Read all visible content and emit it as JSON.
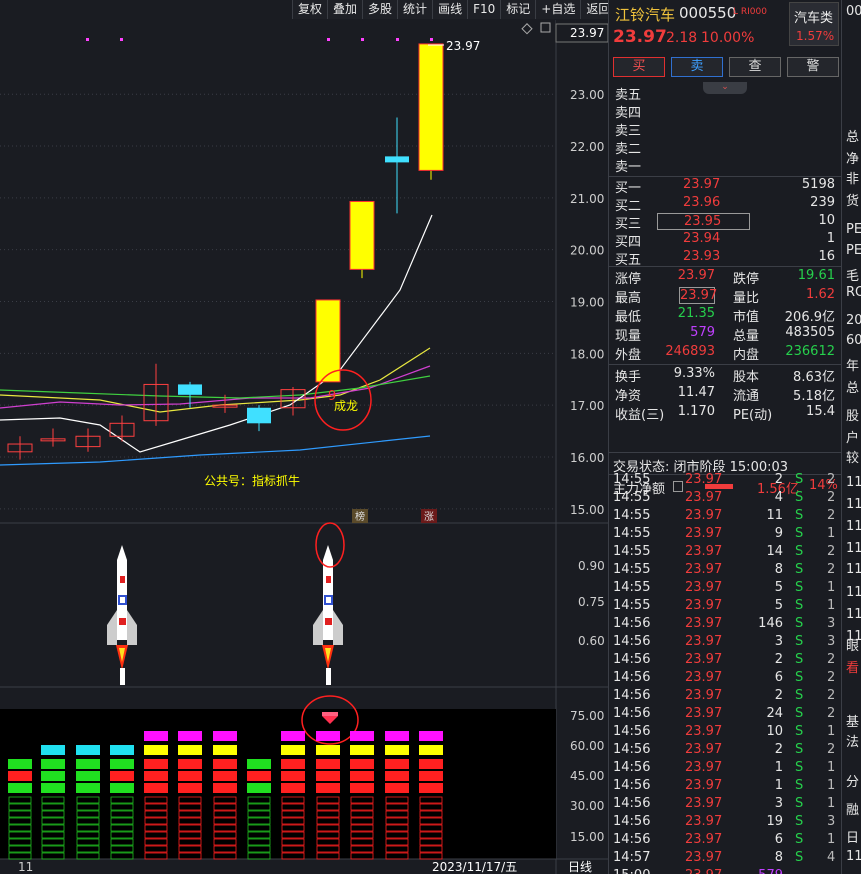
{
  "toolbar": [
    "复权",
    "叠加",
    "多股",
    "统计",
    "画线",
    "F10",
    "标记",
    "+自选",
    "返回"
  ],
  "price_axis": [
    "23.97",
    "23.00",
    "22.00",
    "21.00",
    "20.00",
    "19.00",
    "18.00",
    "17.00",
    "16.00",
    "15.00"
  ],
  "sub_axis": [
    "0.90",
    "0.75",
    "0.60"
  ],
  "vol_axis": [
    "75.00",
    "60.00",
    "45.00",
    "30.00",
    "15.00"
  ],
  "bottom": {
    "left": "11",
    "date": "2023/11/17/五",
    "period": "日线"
  },
  "chart_labels": {
    "high": "23.97",
    "watermark": "公共号：指标抓牛",
    "circle_text": "成龙",
    "circle_num": "9",
    "tag1": "榜",
    "tag2": "涨"
  },
  "chart_data": {
    "type": "candlestick",
    "candles": [
      {
        "o": 16.1,
        "c": 16.25,
        "h": 16.4,
        "l": 15.95
      },
      {
        "o": 16.35,
        "c": 16.35,
        "h": 16.55,
        "l": 16.2
      },
      {
        "o": 16.2,
        "c": 16.4,
        "h": 16.55,
        "l": 16.1
      },
      {
        "o": 16.4,
        "c": 16.65,
        "h": 16.8,
        "l": 16.3
      },
      {
        "o": 16.7,
        "c": 17.4,
        "h": 17.8,
        "l": 16.6
      },
      {
        "o": 17.4,
        "c": 17.2,
        "h": 17.45,
        "l": 16.95
      },
      {
        "o": 17.0,
        "c": 17.0,
        "h": 17.2,
        "l": 16.85
      },
      {
        "o": 16.95,
        "c": 16.65,
        "h": 17.0,
        "l": 16.5
      },
      {
        "o": 16.95,
        "c": 17.3,
        "h": 17.35,
        "l": 16.8
      },
      {
        "o": 17.45,
        "c": 19.03,
        "h": 19.03,
        "l": 17.45
      },
      {
        "o": 19.62,
        "c": 20.93,
        "h": 20.93,
        "l": 19.45
      },
      {
        "o": 21.8,
        "c": 21.8,
        "h": 22.55,
        "l": 20.7
      },
      {
        "o": 21.53,
        "c": 23.97,
        "h": 23.97,
        "l": 21.35
      }
    ],
    "ylim": [
      14.9,
      24.2
    ]
  },
  "quote": {
    "name": "江铃汽车",
    "code": "000550",
    "tag": "L RI000",
    "sector": "汽车类",
    "sector_pct": "1.57%",
    "price": "23.97",
    "change": "2.18",
    "pct": "10.00%"
  },
  "actions": [
    "买",
    "卖",
    "查",
    "警"
  ],
  "sells": [
    "卖五",
    "卖四",
    "卖三",
    "卖二",
    "卖一"
  ],
  "buys": [
    {
      "l": "买一",
      "p": "23.97",
      "v": "5198"
    },
    {
      "l": "买二",
      "p": "23.96",
      "v": "239"
    },
    {
      "l": "买三",
      "p": "23.95",
      "v": "10"
    },
    {
      "l": "买四",
      "p": "23.94",
      "v": "1"
    },
    {
      "l": "买五",
      "p": "23.93",
      "v": "16"
    }
  ],
  "stats": [
    {
      "a": "涨停",
      "av": "23.97",
      "ac": "red",
      "b": "跌停",
      "bv": "19.61",
      "bc": "green"
    },
    {
      "a": "最高",
      "av": "23.97",
      "ac": "red",
      "b": "量比",
      "bv": "1.62",
      "bc": "red"
    },
    {
      "a": "最低",
      "av": "21.35",
      "ac": "green",
      "b": "市值",
      "bv": "206.9亿",
      "bc": "white"
    },
    {
      "a": "现量",
      "av": "579",
      "ac": "purple",
      "b": "总量",
      "bv": "483505",
      "bc": "white"
    },
    {
      "a": "外盘",
      "av": "246893",
      "ac": "red",
      "b": "内盘",
      "bv": "236612",
      "bc": "green"
    }
  ],
  "stats2": [
    {
      "a": "换手",
      "av": "9.33%",
      "b": "股本",
      "bv": "8.63亿"
    },
    {
      "a": "净资",
      "av": "11.47",
      "b": "流通",
      "bv": "5.18亿"
    },
    {
      "a": "收益(三)",
      "av": "1.170",
      "b": "PE(动)",
      "bv": "15.4"
    }
  ],
  "trade_status": "交易状态: 闭市阶段 15:00:03",
  "main_flow": {
    "label": "主力净额",
    "value": "1.56亿",
    "pct": "14%"
  },
  "ticks": [
    [
      "14:55",
      "23.97",
      "2",
      "S",
      "2"
    ],
    [
      "14:55",
      "23.97",
      "4",
      "S",
      "2"
    ],
    [
      "14:55",
      "23.97",
      "11",
      "S",
      "2"
    ],
    [
      "14:55",
      "23.97",
      "9",
      "S",
      "1"
    ],
    [
      "14:55",
      "23.97",
      "14",
      "S",
      "2"
    ],
    [
      "14:55",
      "23.97",
      "8",
      "S",
      "2"
    ],
    [
      "14:55",
      "23.97",
      "5",
      "S",
      "1"
    ],
    [
      "14:55",
      "23.97",
      "5",
      "S",
      "1"
    ],
    [
      "14:56",
      "23.97",
      "146",
      "S",
      "3"
    ],
    [
      "14:56",
      "23.97",
      "3",
      "S",
      "3"
    ],
    [
      "14:56",
      "23.97",
      "2",
      "S",
      "2"
    ],
    [
      "14:56",
      "23.97",
      "6",
      "S",
      "2"
    ],
    [
      "14:56",
      "23.97",
      "2",
      "S",
      "2"
    ],
    [
      "14:56",
      "23.97",
      "24",
      "S",
      "2"
    ],
    [
      "14:56",
      "23.97",
      "10",
      "S",
      "1"
    ],
    [
      "14:56",
      "23.97",
      "2",
      "S",
      "2"
    ],
    [
      "14:56",
      "23.97",
      "1",
      "S",
      "1"
    ],
    [
      "14:56",
      "23.97",
      "1",
      "S",
      "1"
    ],
    [
      "14:56",
      "23.97",
      "3",
      "S",
      "1"
    ],
    [
      "14:56",
      "23.97",
      "19",
      "S",
      "3"
    ],
    [
      "14:56",
      "23.97",
      "6",
      "S",
      "1"
    ],
    [
      "14:57",
      "23.97",
      "8",
      "S",
      "4"
    ],
    [
      "15:00",
      "23.97",
      "579",
      "",
      ""
    ]
  ],
  "far_text": [
    "00",
    "总",
    "净",
    "非",
    "货",
    "PE",
    "PE",
    "毛",
    "RO",
    "20",
    "60",
    "年",
    "总",
    "股",
    "户",
    "较",
    "11",
    "11",
    "11",
    "11",
    "11",
    "11",
    "11",
    "11",
    "眼",
    "看",
    "基",
    "法",
    "分",
    "融",
    "日",
    "11"
  ]
}
